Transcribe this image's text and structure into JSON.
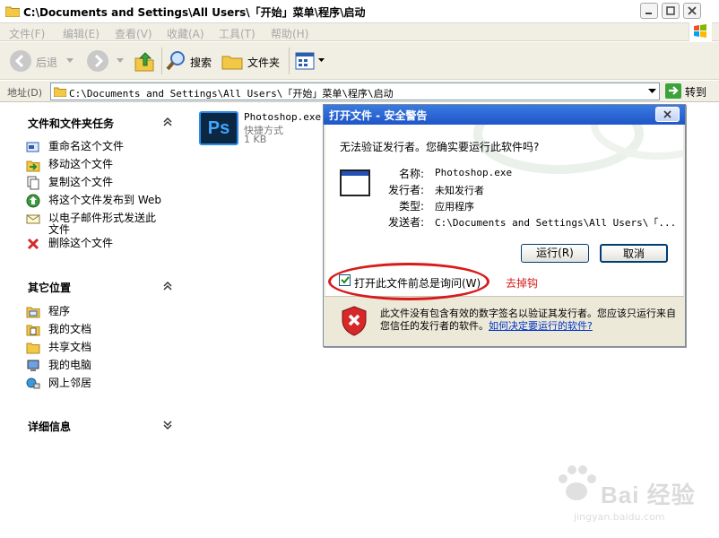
{
  "window": {
    "title": "C:\\Documents and Settings\\All Users\\「开始」菜单\\程序\\启动"
  },
  "menu": [
    "文件(F)",
    "编辑(E)",
    "查看(V)",
    "收藏(A)",
    "工具(T)",
    "帮助(H)"
  ],
  "toolbar": {
    "back_label": "后退",
    "search_label": "搜索",
    "folders_label": "文件夹"
  },
  "address": {
    "label": "地址(D)",
    "value": "C:\\Documents and Settings\\All Users\\「开始」菜单\\程序\\启动",
    "go_label": "转到"
  },
  "tasks": {
    "file_tasks_title": "文件和文件夹任务",
    "file_tasks": [
      {
        "label": "重命名这个文件",
        "icon": "rename-icon"
      },
      {
        "label": "移动这个文件",
        "icon": "move-icon"
      },
      {
        "label": "复制这个文件",
        "icon": "copy-icon"
      },
      {
        "label": "将这个文件发布到 Web",
        "icon": "publish-web-icon"
      },
      {
        "label": "以电子邮件形式发送此文件",
        "icon": "email-icon"
      },
      {
        "label": "删除这个文件",
        "icon": "delete-icon"
      }
    ],
    "other_places_title": "其它位置",
    "other_places": [
      {
        "label": "程序",
        "icon": "folder-icon"
      },
      {
        "label": "我的文档",
        "icon": "my-documents-icon"
      },
      {
        "label": "共享文档",
        "icon": "shared-folder-icon"
      },
      {
        "label": "我的电脑",
        "icon": "my-computer-icon"
      },
      {
        "label": "网上邻居",
        "icon": "network-icon"
      }
    ],
    "details_title": "详细信息"
  },
  "file": {
    "icon_text": "Ps",
    "name": "Photoshop.exe",
    "type": "快捷方式",
    "size": "1 KB"
  },
  "dialog": {
    "title": "打开文件 - 安全警告",
    "question": "无法验证发行者。您确实要运行此软件吗?",
    "fields": [
      {
        "key": "名称:",
        "value": "Photoshop.exe"
      },
      {
        "key": "发行者:",
        "value": "未知发行者"
      },
      {
        "key": "类型:",
        "value": "应用程序"
      },
      {
        "key": "发送者:",
        "value": "C:\\Documents and Settings\\All Users\\「..."
      }
    ],
    "run_label": "运行(R)",
    "cancel_label": "取消",
    "checkbox_label": "打开此文件前总是询问(W)",
    "checkbox_checked": true,
    "warning_text": "此文件没有包含有效的数字签名以验证其发行者。您应该只运行来自您信任的发行者的软件。",
    "warning_link": "如何决定要运行的软件?"
  },
  "annotation": {
    "text": "去掉钩",
    "color": "#d81a1a"
  },
  "watermark": {
    "brand": "Bai 经验",
    "url": "jingyan.baidu.com"
  },
  "colors": {
    "dialog_title_bg": "#245edb",
    "toolbar_bg": "#f1efe4",
    "link": "#0033cc"
  }
}
